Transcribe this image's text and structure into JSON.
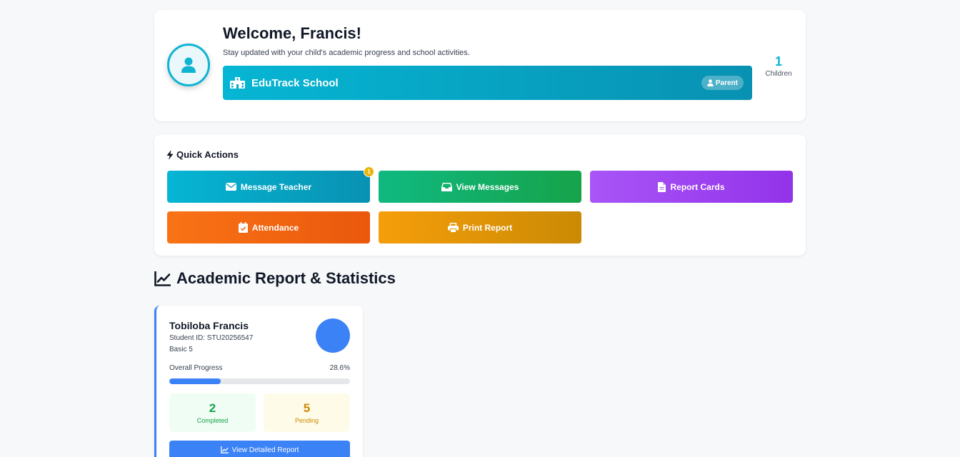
{
  "header": {
    "welcome_title": "Welcome, Francis!",
    "subtitle": "Stay updated with your child's academic progress and school activities.",
    "school_name": "EduTrack School",
    "role": "Parent",
    "children_count": "1",
    "children_label": "Children"
  },
  "quick_actions": {
    "title": "Quick Actions",
    "buttons": [
      {
        "label": "Message Teacher",
        "icon": "envelope-icon",
        "badge": "1"
      },
      {
        "label": "View Messages",
        "icon": "inbox-icon"
      },
      {
        "label": "Report Cards",
        "icon": "file-icon"
      },
      {
        "label": "Attendance",
        "icon": "calendar-check-icon"
      },
      {
        "label": "Print Report",
        "icon": "printer-icon"
      }
    ]
  },
  "academic": {
    "section_title": "Academic Report & Statistics",
    "student": {
      "name": "Tobiloba Francis",
      "student_id": "Student ID: STU20256547",
      "class": "Basic 5",
      "progress_label": "Overall Progress",
      "progress_text": "28.6%",
      "progress_value": 0.286,
      "completed_count": "2",
      "completed_label": "Completed",
      "pending_count": "5",
      "pending_label": "Pending",
      "detail_button": "View Detailed Report"
    }
  },
  "colors": {
    "accent": "#0fb4d3",
    "primary_blue": "#3b82f6",
    "green": "#16a34a",
    "amber": "#ca8a04",
    "purple": "#9333ea",
    "orange": "#ea580c"
  }
}
